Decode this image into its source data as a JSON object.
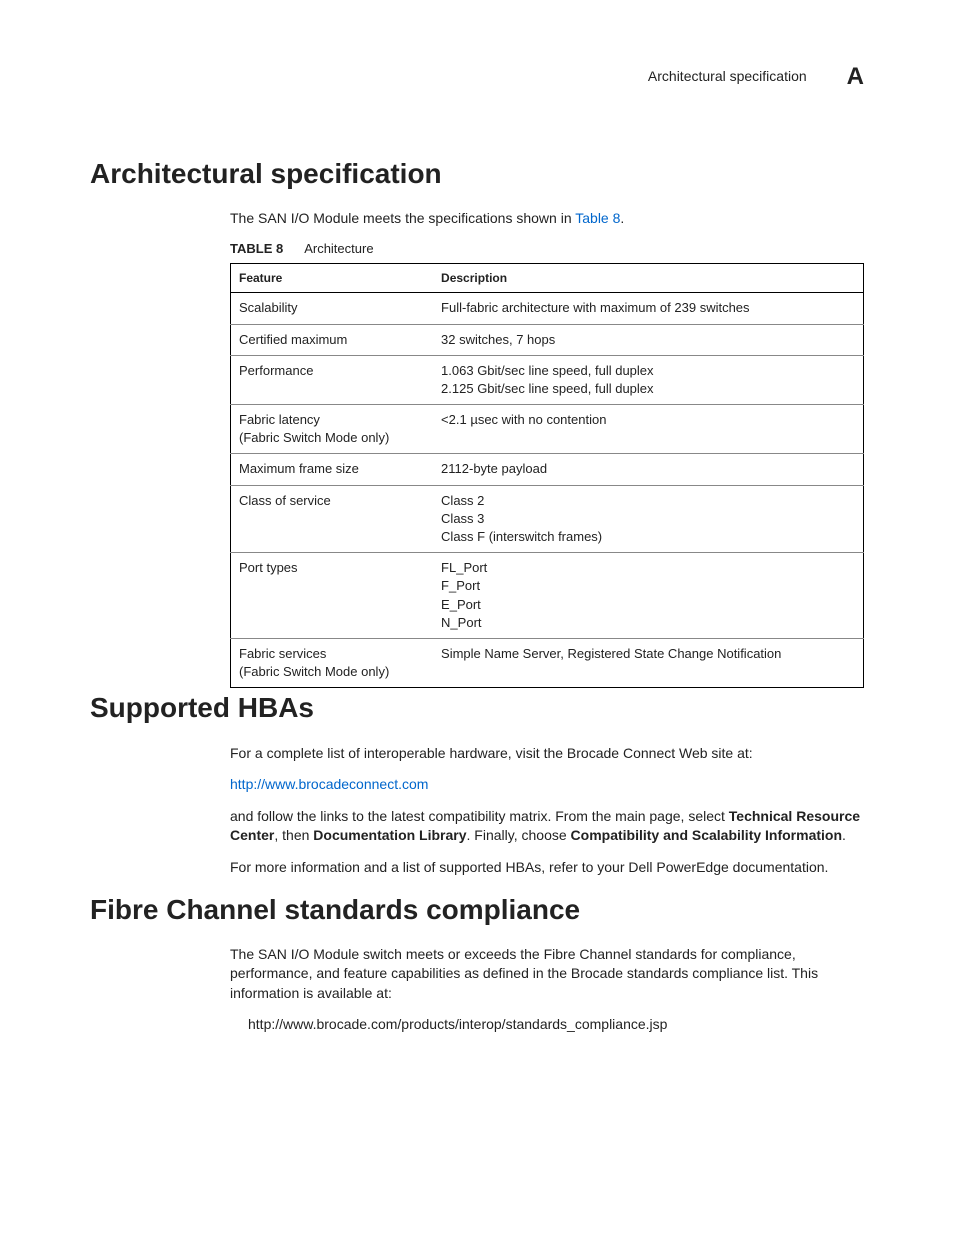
{
  "runningHead": {
    "title": "Architectural specification",
    "appendix": "A"
  },
  "sections": {
    "arch": {
      "heading": "Architectural specification",
      "intro_pre": "The SAN I/O Module meets the specifications shown in ",
      "intro_link": "Table 8",
      "intro_post": ".",
      "table_label": "TABLE 8",
      "table_title": "Architecture",
      "headers": {
        "feature": "Feature",
        "description": "Description"
      },
      "rows": [
        {
          "f": "Scalability",
          "d": "Full-fabric architecture with maximum of 239 switches"
        },
        {
          "f": "Certified maximum",
          "d": "32 switches, 7 hops"
        },
        {
          "f": "Performance",
          "d": "1.063 Gbit/sec line speed, full duplex\n2.125 Gbit/sec line speed, full duplex"
        },
        {
          "f": "Fabric latency\n(Fabric Switch Mode only)",
          "d": "<2.1 µsec with no contention"
        },
        {
          "f": "Maximum frame size",
          "d": "2112-byte payload"
        },
        {
          "f": "Class of service",
          "d": "Class 2\nClass 3\nClass F (interswitch frames)"
        },
        {
          "f": "Port types",
          "d": "FL_Port\nF_Port\nE_Port\nN_Port"
        },
        {
          "f": "Fabric services\n(Fabric Switch Mode only)",
          "d": "Simple Name Server, Registered State Change Notification"
        }
      ]
    },
    "hbas": {
      "heading": "Supported HBAs",
      "p1": "For a complete list of interoperable hardware, visit the Brocade Connect Web site at:",
      "link": "http://www.brocadeconnect.com",
      "p2_a": "and follow the links to the latest compatibility matrix. From the main page, select ",
      "p2_b1": "Technical Resource Center",
      "p2_c": ", then ",
      "p2_b2": "Documentation Library",
      "p2_d": ". Finally, choose ",
      "p2_b3": "Compatibility and Scalability Information",
      "p2_e": ".",
      "p3": "For more information and a list of supported HBAs, refer to your Dell PowerEdge documentation."
    },
    "fc": {
      "heading": "Fibre Channel standards compliance",
      "p1": "The SAN I/O Module switch meets or exceeds the Fibre Channel standards for compliance, performance, and feature capabilities as defined in the Brocade standards compliance list. This information is available at:",
      "url": "http://www.brocade.com/products/interop/standards_compliance.jsp"
    }
  }
}
